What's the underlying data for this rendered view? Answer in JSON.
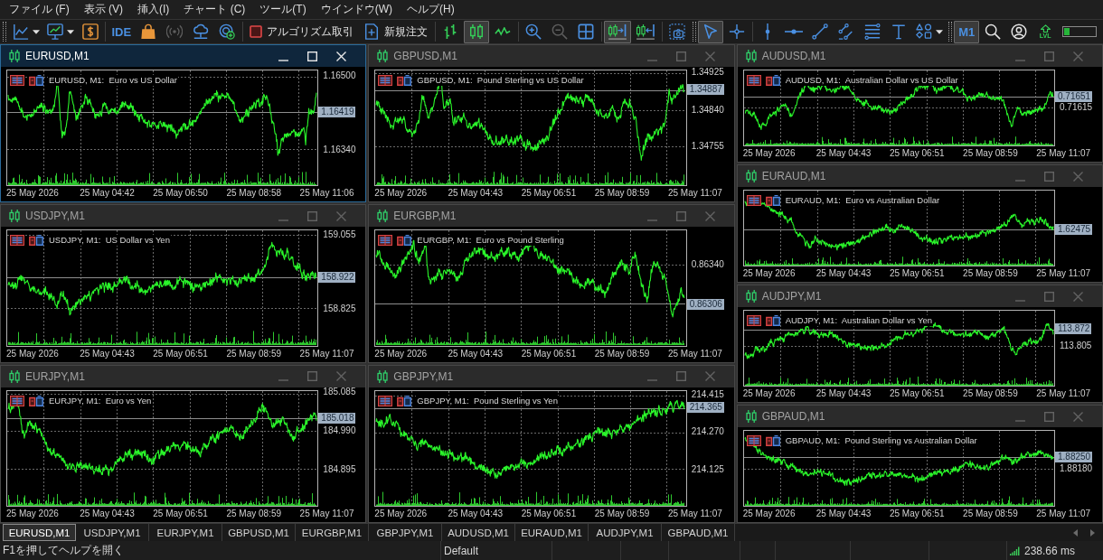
{
  "menu": [
    "ファイル (F)",
    "表示 (V)",
    "挿入(I)",
    "チャート (C)",
    "ツール(T)",
    "ウインドウ(W)",
    "ヘルプ(H)"
  ],
  "toolbar": [
    {
      "kind": "icon_menu",
      "pressed": false,
      "disabled": false
    },
    {
      "kind": "icon_menu",
      "pressed": false,
      "disabled": false
    },
    {
      "kind": "icon",
      "pressed": false,
      "disabled": false
    },
    {
      "kind": "text",
      "label": "IDE",
      "pressed": false,
      "disabled": false
    },
    {
      "kind": "icon",
      "pressed": false,
      "disabled": false
    },
    {
      "kind": "icon",
      "pressed": false,
      "disabled": true
    },
    {
      "kind": "icon",
      "pressed": false,
      "disabled": false
    },
    {
      "kind": "icon",
      "pressed": false,
      "disabled": false
    },
    {
      "kind": "icon_label",
      "label": "アルゴリズム取引",
      "pressed": false,
      "disabled": false
    },
    {
      "kind": "icon_label",
      "label": "新規注文",
      "pressed": false,
      "disabled": false
    },
    {
      "kind": "icon",
      "pressed": false,
      "disabled": false
    },
    {
      "kind": "icon",
      "pressed": true,
      "disabled": false
    },
    {
      "kind": "icon",
      "pressed": false,
      "disabled": false
    },
    {
      "kind": "icon",
      "pressed": false,
      "disabled": false
    },
    {
      "kind": "icon",
      "pressed": false,
      "disabled": true
    },
    {
      "kind": "icon",
      "pressed": false,
      "disabled": false
    },
    {
      "kind": "icon",
      "pressed": true,
      "disabled": false
    },
    {
      "kind": "icon",
      "pressed": false,
      "disabled": false
    },
    {
      "kind": "icon",
      "pressed": false,
      "disabled": false
    },
    {
      "kind": "icon",
      "pressed": true,
      "disabled": false
    },
    {
      "kind": "icon",
      "pressed": false,
      "disabled": false
    },
    {
      "kind": "icon",
      "pressed": false,
      "disabled": false
    },
    {
      "kind": "icon",
      "pressed": false,
      "disabled": false
    },
    {
      "kind": "icon",
      "pressed": false,
      "disabled": false
    },
    {
      "kind": "icon",
      "pressed": false,
      "disabled": false
    },
    {
      "kind": "icon",
      "pressed": false,
      "disabled": false
    },
    {
      "kind": "icon",
      "pressed": false,
      "disabled": false
    },
    {
      "kind": "icon_menu",
      "pressed": false,
      "disabled": false
    },
    {
      "kind": "text",
      "label": "M1",
      "pressed": true,
      "disabled": false
    },
    {
      "kind": "icon",
      "pressed": false,
      "disabled": false
    },
    {
      "kind": "icon",
      "pressed": false,
      "disabled": false
    },
    {
      "kind": "icon_caption",
      "label": "LVL",
      "pressed": false,
      "disabled": false
    },
    {
      "kind": "meter",
      "level": 0.2,
      "pressed": false,
      "disabled": false
    }
  ],
  "workspace": {
    "columns": [
      {
        "windows": [
          {
            "title": "EURUSD,M1",
            "active": true,
            "legend": "EURUSD, M1:  Euro vs US Dollar",
            "price_labels": [
              "1.16500",
              "1.16340"
            ],
            "current_price": "1.16419",
            "time_labels": [
              "25 May 2026",
              "25 May 04:42",
              "25 May 06:50",
              "25 May 08:58",
              "25 May 11:06"
            ]
          },
          {
            "title": "USDJPY,M1",
            "active": false,
            "legend": "USDJPY, M1:  US Dollar vs Yen",
            "price_labels": [
              "159.055",
              "158.825"
            ],
            "current_price": "158.922",
            "time_labels": [
              "25 May 2026",
              "25 May 04:43",
              "25 May 06:51",
              "25 May 08:59",
              "25 May 11:07"
            ]
          },
          {
            "title": "EURJPY,M1",
            "active": false,
            "legend": "EURJPY, M1:  Euro vs Yen",
            "price_labels": [
              "185.085",
              "184.990",
              "184.895"
            ],
            "current_price": "185.018",
            "time_labels": [
              "25 May 2026",
              "25 May 04:43",
              "25 May 06:51",
              "25 May 08:59",
              "25 May 11:07"
            ]
          }
        ]
      },
      {
        "windows": [
          {
            "title": "GBPUSD,M1",
            "active": false,
            "legend": "GBPUSD, M1:  Pound Sterling vs US Dollar",
            "price_labels": [
              "1.34925",
              "1.34840",
              "1.34755"
            ],
            "current_price": "1.34887",
            "time_labels": [
              "25 May 2026",
              "25 May 04:43",
              "25 May 06:51",
              "25 May 08:59",
              "25 May 11:07"
            ]
          },
          {
            "title": "EURGBP,M1",
            "active": false,
            "legend": "EURGBP, M1:  Euro vs Pound Sterling",
            "price_labels": [
              "0.86340"
            ],
            "current_price": "0.86306",
            "time_labels": [
              "25 May 2026",
              "25 May 04:43",
              "25 May 06:51",
              "25 May 08:59",
              "25 May 11:07"
            ]
          },
          {
            "title": "GBPJPY,M1",
            "active": false,
            "legend": "GBPJPY, M1:  Pound Sterling vs Yen",
            "price_labels": [
              "214.415",
              "214.270",
              "214.125"
            ],
            "current_price": "214.365",
            "time_labels": [
              "25 May 2026",
              "25 May 04:43",
              "25 May 06:51",
              "25 May 08:59",
              "25 May 11:07"
            ]
          }
        ]
      },
      {
        "windows": [
          {
            "title": "AUDUSD,M1",
            "active": false,
            "legend": "AUDUSD, M1:  Australian Dollar vs US Dollar",
            "price_labels": [
              "0.71615"
            ],
            "current_price": "0.71651",
            "time_labels": [
              "25 May 2026",
              "25 May 04:43",
              "25 May 06:51",
              "25 May 08:59",
              "25 May 11:07"
            ]
          },
          {
            "title": "EURAUD,M1",
            "active": false,
            "legend": "EURAUD, M1:  Euro vs Australian Dollar",
            "current_price": "1.62475",
            "time_labels": [
              "25 May 2026",
              "25 May 04:43",
              "25 May 06:51",
              "25 May 08:59",
              "25 May 11:07"
            ]
          },
          {
            "title": "AUDJPY,M1",
            "active": false,
            "legend": "AUDJPY, M1:  Australian Dollar vs Yen",
            "price_labels": [
              "113.805"
            ],
            "current_price": "113.872",
            "time_labels": [
              "25 May 2026",
              "25 May 04:43",
              "25 May 06:51",
              "25 May 08:59",
              "25 May 11:07"
            ]
          },
          {
            "title": "GBPAUD,M1",
            "active": false,
            "legend": "GBPAUD, M1:  Pound Sterling vs Australian Dollar",
            "price_labels": [
              "1.88180"
            ],
            "current_price": "1.88250",
            "time_labels": [
              "25 May 2026",
              "25 May 04:43",
              "25 May 06:51",
              "25 May 08:59",
              "25 May 11:07"
            ]
          }
        ]
      }
    ]
  },
  "tabs": [
    {
      "label": "EURUSD,M1",
      "selected": true
    },
    {
      "label": "USDJPY,M1",
      "selected": false
    },
    {
      "label": "EURJPY,M1",
      "selected": false
    },
    {
      "label": "GBPUSD,M1",
      "selected": false
    },
    {
      "label": "EURGBP,M1",
      "selected": false
    },
    {
      "label": "GBPJPY,M1",
      "selected": false
    },
    {
      "label": "AUDUSD,M1",
      "selected": false
    },
    {
      "label": "EURAUD,M1",
      "selected": false
    },
    {
      "label": "AUDJPY,M1",
      "selected": false
    },
    {
      "label": "GBPAUD,M1",
      "selected": false
    }
  ],
  "status_bar": {
    "help": "F1を押してヘルプを開く",
    "profile": "Default",
    "ping": "238.66 ms"
  }
}
